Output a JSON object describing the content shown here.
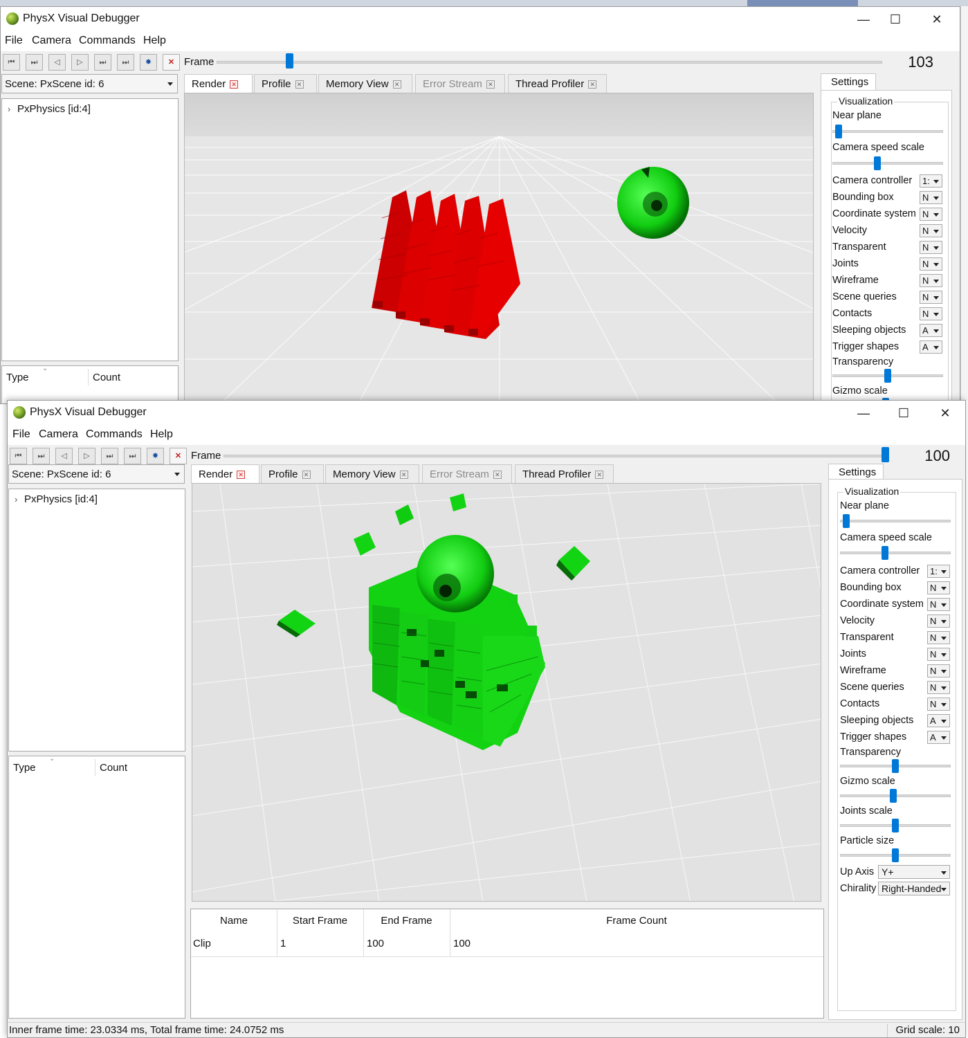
{
  "app": {
    "title": "PhysX Visual Debugger",
    "window_controls": {
      "minimize": "—",
      "maximize": "☐",
      "close": "✕"
    }
  },
  "menu": {
    "file": "File",
    "camera": "Camera",
    "commands": "Commands",
    "help": "Help"
  },
  "toolbar": {
    "buttons": [
      "⏮",
      "⏭",
      "◁",
      "▷",
      "⏭",
      "⏭",
      "✸",
      "✕"
    ],
    "frame_label": "Frame"
  },
  "colors": {
    "accent": "#0078d7",
    "viewport_bg": "#e4e4e4",
    "stack_red": "#dd0000",
    "stack_green": "#11dd11"
  },
  "top_window": {
    "frame_value": "103",
    "frame_fraction": 0.12,
    "scene": "Scene: PxScene id: 6",
    "tree_item": "PxPhysics [id:4]",
    "type_col": "Type",
    "count_col": "Count",
    "tabs": [
      "Render",
      "Profile",
      "Memory View",
      "Error Stream",
      "Thread Profiler"
    ],
    "settings": {
      "tab": "Settings",
      "group": "Visualization",
      "near_plane": "Near plane",
      "camera_speed_scale": "Camera speed scale",
      "rows": [
        {
          "label": "Camera controller",
          "value": "1:"
        },
        {
          "label": "Bounding box",
          "value": "N"
        },
        {
          "label": "Coordinate system",
          "value": "N"
        },
        {
          "label": "Velocity",
          "value": "N"
        },
        {
          "label": "Transparent",
          "value": "N"
        },
        {
          "label": "Joints",
          "value": "N"
        },
        {
          "label": "Wireframe",
          "value": "N"
        },
        {
          "label": "Scene queries",
          "value": "N"
        },
        {
          "label": "Contacts",
          "value": "N"
        },
        {
          "label": "Sleeping objects",
          "value": "A"
        },
        {
          "label": "Trigger shapes",
          "value": "A"
        }
      ],
      "transparency": "Transparency",
      "gizmo_scale": "Gizmo scale"
    }
  },
  "bottom_window": {
    "frame_value": "100",
    "frame_fraction": 1.0,
    "scene": "Scene: PxScene id: 6",
    "tree_item": "PxPhysics [id:4]",
    "type_col": "Type",
    "count_col": "Count",
    "tabs": [
      "Render",
      "Profile",
      "Memory View",
      "Error Stream",
      "Thread Profiler"
    ],
    "settings": {
      "tab": "Settings",
      "group": "Visualization",
      "near_plane": "Near plane",
      "camera_speed_scale": "Camera speed scale",
      "rows": [
        {
          "label": "Camera controller",
          "value": "1:"
        },
        {
          "label": "Bounding box",
          "value": "N"
        },
        {
          "label": "Coordinate system",
          "value": "N"
        },
        {
          "label": "Velocity",
          "value": "N"
        },
        {
          "label": "Transparent",
          "value": "N"
        },
        {
          "label": "Joints",
          "value": "N"
        },
        {
          "label": "Wireframe",
          "value": "N"
        },
        {
          "label": "Scene queries",
          "value": "N"
        },
        {
          "label": "Contacts",
          "value": "N"
        },
        {
          "label": "Sleeping objects",
          "value": "A"
        },
        {
          "label": "Trigger shapes",
          "value": "A"
        }
      ],
      "transparency": "Transparency",
      "gizmo_scale": "Gizmo scale",
      "joints_scale": "Joints scale",
      "particle_size": "Particle size",
      "up_axis_label": "Up Axis",
      "up_axis_value": "Y+",
      "chirality_label": "Chirality",
      "chirality_value": "Right-Handed"
    },
    "clips": {
      "headers": [
        "Name",
        "Start Frame",
        "End Frame",
        "Frame Count"
      ],
      "rows": [
        [
          "Clip",
          "1",
          "100",
          "100"
        ]
      ]
    },
    "status": {
      "timing": "Inner frame time: 23.0334 ms, Total frame time: 24.0752 ms",
      "grid_scale": "Grid scale: 10"
    }
  }
}
